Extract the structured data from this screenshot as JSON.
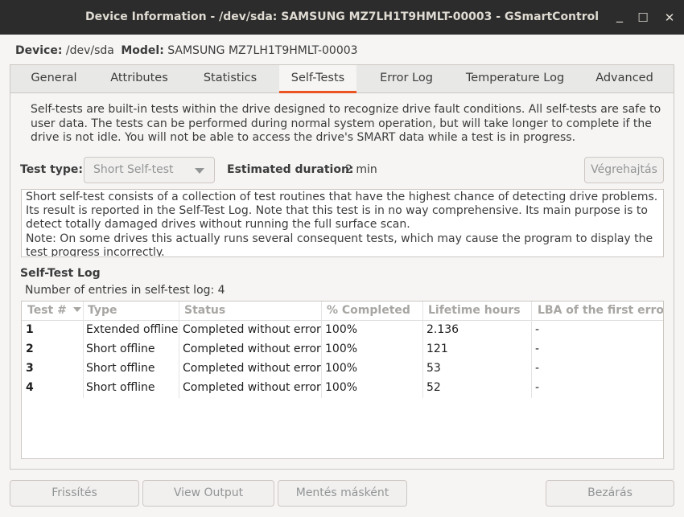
{
  "window": {
    "title": "Device Information - /dev/sda: SAMSUNG MZ7LH1T9HMLT-00003 - GSmartControl",
    "minimize_glyph": "_",
    "maximize_glyph": "☐",
    "close_glyph": "✕"
  },
  "device": {
    "device_label": "Device:",
    "device_value": "/dev/sda",
    "model_label": "Model:",
    "model_value": "SAMSUNG MZ7LH1T9HMLT-00003"
  },
  "tabs": [
    {
      "label": "General"
    },
    {
      "label": "Attributes"
    },
    {
      "label": "Statistics"
    },
    {
      "label": "Self-Tests"
    },
    {
      "label": "Error Log"
    },
    {
      "label": "Temperature Log"
    },
    {
      "label": "Advanced"
    }
  ],
  "active_tab": "Self-Tests",
  "selftests": {
    "description": "Self-tests are built-in tests within the drive designed to recognize drive fault conditions. All self-tests are safe to user data. The tests can be performed during normal system operation, but will take longer to complete if the drive is not idle. You will not be able to access the drive's SMART data while a test is in progress.",
    "test_type_label": "Test type:",
    "test_type_value": "Short Self-test",
    "duration_label": "Estimated duration:",
    "duration_value": "2 min",
    "execute_button": "Végrehajtás",
    "test_description": "Short self-test consists of a collection of test routines that have the highest chance of detecting drive problems. Its result is reported in the Self-Test Log. Note that this test is in no way comprehensive. Its main purpose is to detect totally damaged drives without running the full surface scan.\nNote: On some drives this actually runs several consequent tests, which may cause the program to display the test progress incorrectly.",
    "log_title": "Self-Test Log",
    "entries_text": "Number of entries in self-test log: 4",
    "columns": [
      "Test #",
      "Type",
      "Status",
      "% Completed",
      "Lifetime hours",
      "LBA of the first error"
    ],
    "rows": [
      [
        "1",
        "Extended offline",
        "Completed without error",
        "100%",
        "2.136",
        "-"
      ],
      [
        "2",
        "Short offline",
        "Completed without error",
        "100%",
        "121",
        "-"
      ],
      [
        "3",
        "Short offline",
        "Completed without error",
        "100%",
        "53",
        "-"
      ],
      [
        "4",
        "Short offline",
        "Completed without error",
        "100%",
        "52",
        "-"
      ]
    ]
  },
  "footer": {
    "refresh_button": "Frissítés",
    "view_output_button": "View Output",
    "save_as_button": "Mentés másként",
    "close_button": "Bezárás"
  },
  "colors": {
    "accent": "#e95420",
    "titlebar": "#2c2c2c"
  }
}
